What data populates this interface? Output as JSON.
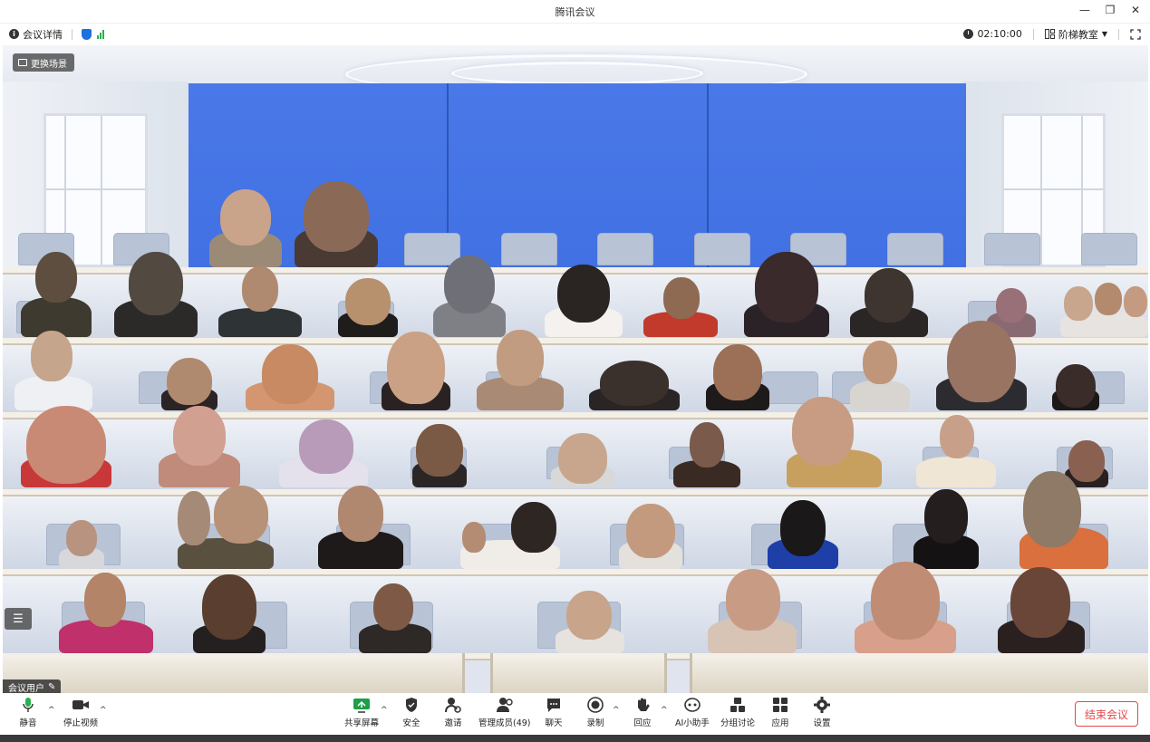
{
  "window": {
    "title": "腾讯会议",
    "minimize": "—",
    "restore": "❐",
    "close": "✕"
  },
  "infobar": {
    "meeting_details": "会议详情",
    "timer": "02:10:00",
    "view_mode": "阶梯教室"
  },
  "stage": {
    "change_scene": "更换场景",
    "user_tag": "会议用户"
  },
  "toolbar": {
    "mute": "静音",
    "stop_video": "停止视频",
    "share_screen": "共享屏幕",
    "security": "安全",
    "invite": "邀请",
    "manage_members": "管理成员(49)",
    "chat": "聊天",
    "record": "录制",
    "reactions": "回应",
    "ai_assistant": "AI小助手",
    "breakout": "分组讨论",
    "apps": "应用",
    "settings": "设置",
    "end_meeting": "结束会议"
  },
  "colors": {
    "accent_blue": "#1e6fe0",
    "mic_green": "#29b04a",
    "end_red": "#e44848",
    "board_blue": "#4a78e8"
  }
}
